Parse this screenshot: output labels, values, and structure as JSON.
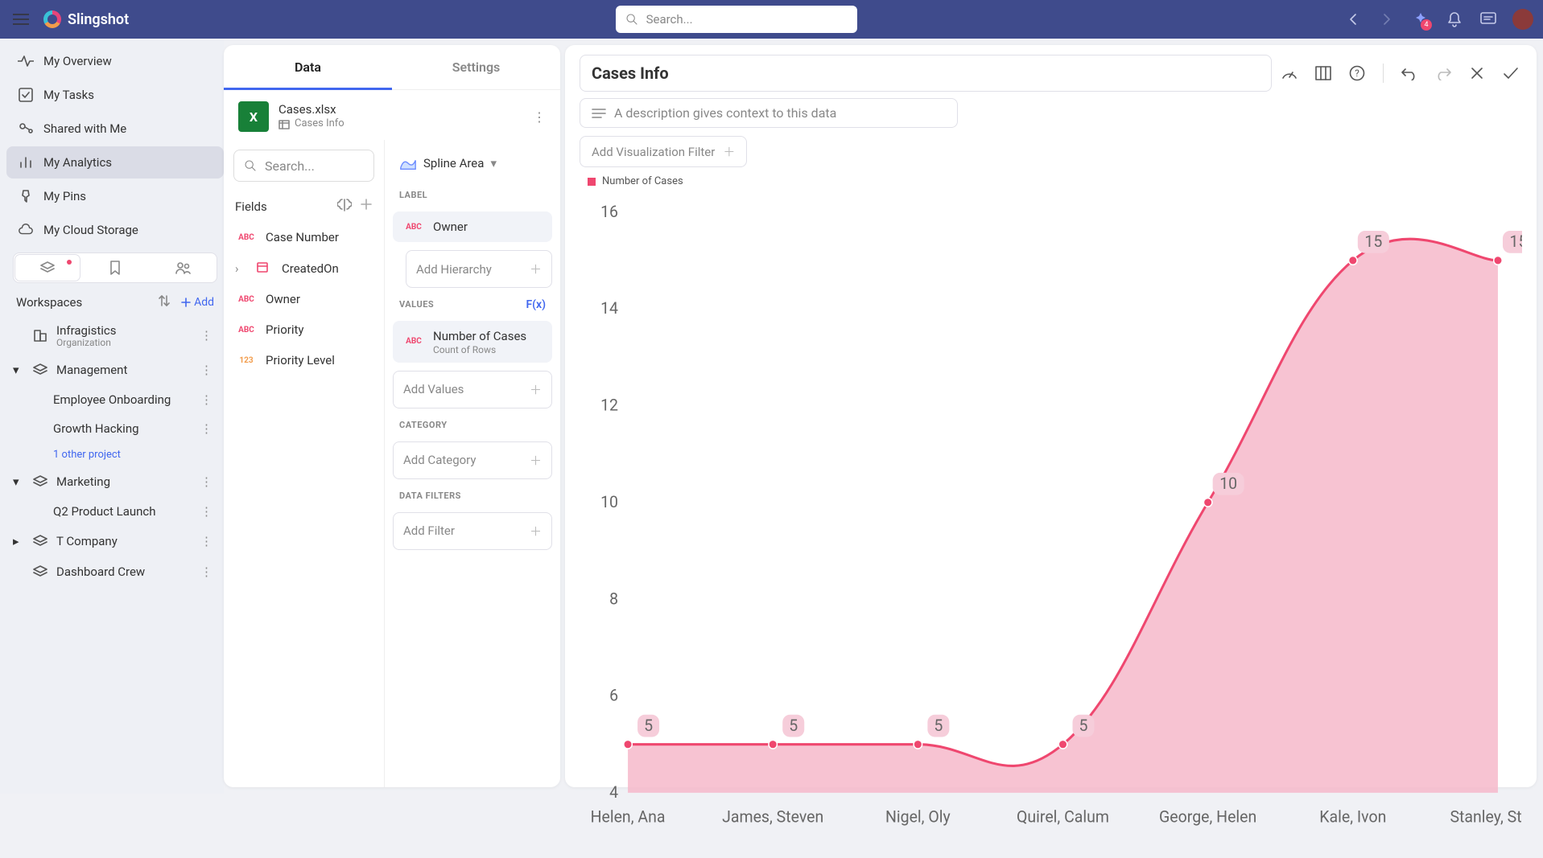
{
  "topbar": {
    "brand": "Slingshot",
    "search_placeholder": "Search...",
    "notif_badge": "4"
  },
  "sidebar": {
    "nav": [
      {
        "label": "My Overview",
        "icon": "activity"
      },
      {
        "label": "My Tasks",
        "icon": "checkbox"
      },
      {
        "label": "Shared with Me",
        "icon": "share"
      },
      {
        "label": "My Analytics",
        "icon": "chart",
        "active": true
      },
      {
        "label": "My Pins",
        "icon": "pin"
      },
      {
        "label": "My Cloud Storage",
        "icon": "cloud"
      }
    ],
    "workspaces_label": "Workspaces",
    "add_label": "Add",
    "workspaces": [
      {
        "name": "Infragistics",
        "sub": "Organization",
        "icon": "building"
      },
      {
        "name": "Management",
        "icon": "layers",
        "children": [
          {
            "name": "Employee Onboarding"
          },
          {
            "name": "Growth Hacking"
          }
        ],
        "more_link": "1 other project"
      },
      {
        "name": "Marketing",
        "icon": "layers",
        "children": [
          {
            "name": "Q2 Product Launch"
          }
        ]
      },
      {
        "name": "T Company",
        "icon": "layers"
      },
      {
        "name": "Dashboard Crew",
        "icon": "layers"
      }
    ]
  },
  "datapanel": {
    "tabs": {
      "data": "Data",
      "settings": "Settings"
    },
    "datasource": {
      "file": "Cases.xlsx",
      "sheet": "Cases Info"
    },
    "fields_search_placeholder": "Search...",
    "fields_label": "Fields",
    "fields": [
      {
        "name": "Case Number",
        "type": "ABC"
      },
      {
        "name": "CreatedOn",
        "type": "DATE",
        "expandable": true
      },
      {
        "name": "Owner",
        "type": "ABC"
      },
      {
        "name": "Priority",
        "type": "ABC"
      },
      {
        "name": "Priority Level",
        "type": "123"
      }
    ],
    "config": {
      "viz_type": "Spline Area",
      "sections": {
        "label": {
          "title": "LABEL",
          "chip": "Owner",
          "add": "Add Hierarchy"
        },
        "values": {
          "title": "VALUES",
          "fx": "F(x)",
          "chip": "Number of Cases",
          "chip_sub": "Count of Rows",
          "add": "Add Values"
        },
        "category": {
          "title": "CATEGORY",
          "add": "Add Category"
        },
        "filters": {
          "title": "DATA FILTERS",
          "add": "Add Filter"
        }
      }
    }
  },
  "chart": {
    "title": "Cases Info",
    "desc_placeholder": "A description gives context to this data",
    "add_filter": "Add Visualization Filter",
    "legend": "Number of Cases"
  },
  "chart_data": {
    "type": "area",
    "title": "Cases Info",
    "xlabel": "",
    "ylabel": "",
    "ylim": [
      4,
      16
    ],
    "yticks": [
      4,
      6,
      8,
      10,
      12,
      14,
      16
    ],
    "categories": [
      "Helen, Ana",
      "James, Steven",
      "Nigel, Oly",
      "Quirel, Calum",
      "George, Helen",
      "Kale, Ivon",
      "Stanley, Steve"
    ],
    "series": [
      {
        "name": "Number of Cases",
        "color": "#ef476f",
        "values": [
          5,
          5,
          5,
          5,
          10,
          15,
          15
        ]
      }
    ]
  }
}
